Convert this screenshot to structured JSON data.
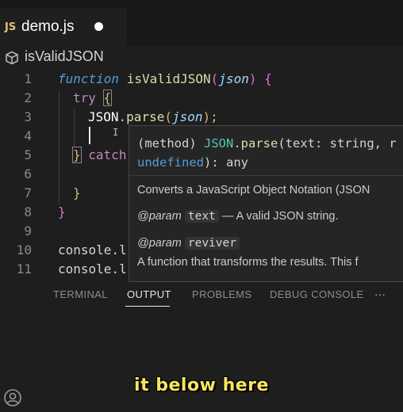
{
  "tab": {
    "lang_icon": "JS",
    "filename": "demo.js",
    "dirty_indicator": "modified-dot"
  },
  "breadcrumb": {
    "icon": "symbol-method-icon",
    "label": "isValidJSON"
  },
  "gutter": [
    "1",
    "2",
    "3",
    "4",
    "5",
    "6",
    "7",
    "8",
    "9",
    "10",
    "11"
  ],
  "code": {
    "l1": {
      "kw": "function",
      "fn": "isValidJSON",
      "open_paren": "(",
      "param": "json",
      "close": ") {"
    },
    "l2": {
      "kw": "try",
      "brace": "{"
    },
    "l3": {
      "obj": "JSON",
      "dot": ".",
      "fn": "parse",
      "open": "(",
      "param": "json",
      "close": ");"
    },
    "l5": {
      "brace": "}",
      "kw": "catch"
    },
    "l7": {
      "brace": "}"
    },
    "l8": {
      "brace": "}"
    },
    "l10": {
      "text": "console.l"
    },
    "l11": {
      "text": "console.l"
    }
  },
  "hover": {
    "sig_line1": {
      "a": "(method) ",
      "b": "JSON",
      "c": ".",
      "d": "parse",
      "e": "(text: string, r"
    },
    "sig_line2": {
      "a": "undefined",
      "b": "): any"
    },
    "description": "Converts a JavaScript Object Notation (JSON",
    "param1": {
      "tag": "@param",
      "name": "text",
      "desc": "— A valid JSON string."
    },
    "param2": {
      "tag": "@param",
      "name": "reviver"
    },
    "param2_desc": "A function that transforms the results. This f"
  },
  "panel": {
    "tabs": [
      "TERMINAL",
      "OUTPUT",
      "PROBLEMS",
      "DEBUG CONSOLE"
    ],
    "active": "OUTPUT",
    "more": "···"
  },
  "caption": "it below here",
  "colors": {
    "keyword": "#569cd6",
    "function": "#dcdcaa",
    "param": "#9cdcfe",
    "caption": "#f5e663"
  }
}
